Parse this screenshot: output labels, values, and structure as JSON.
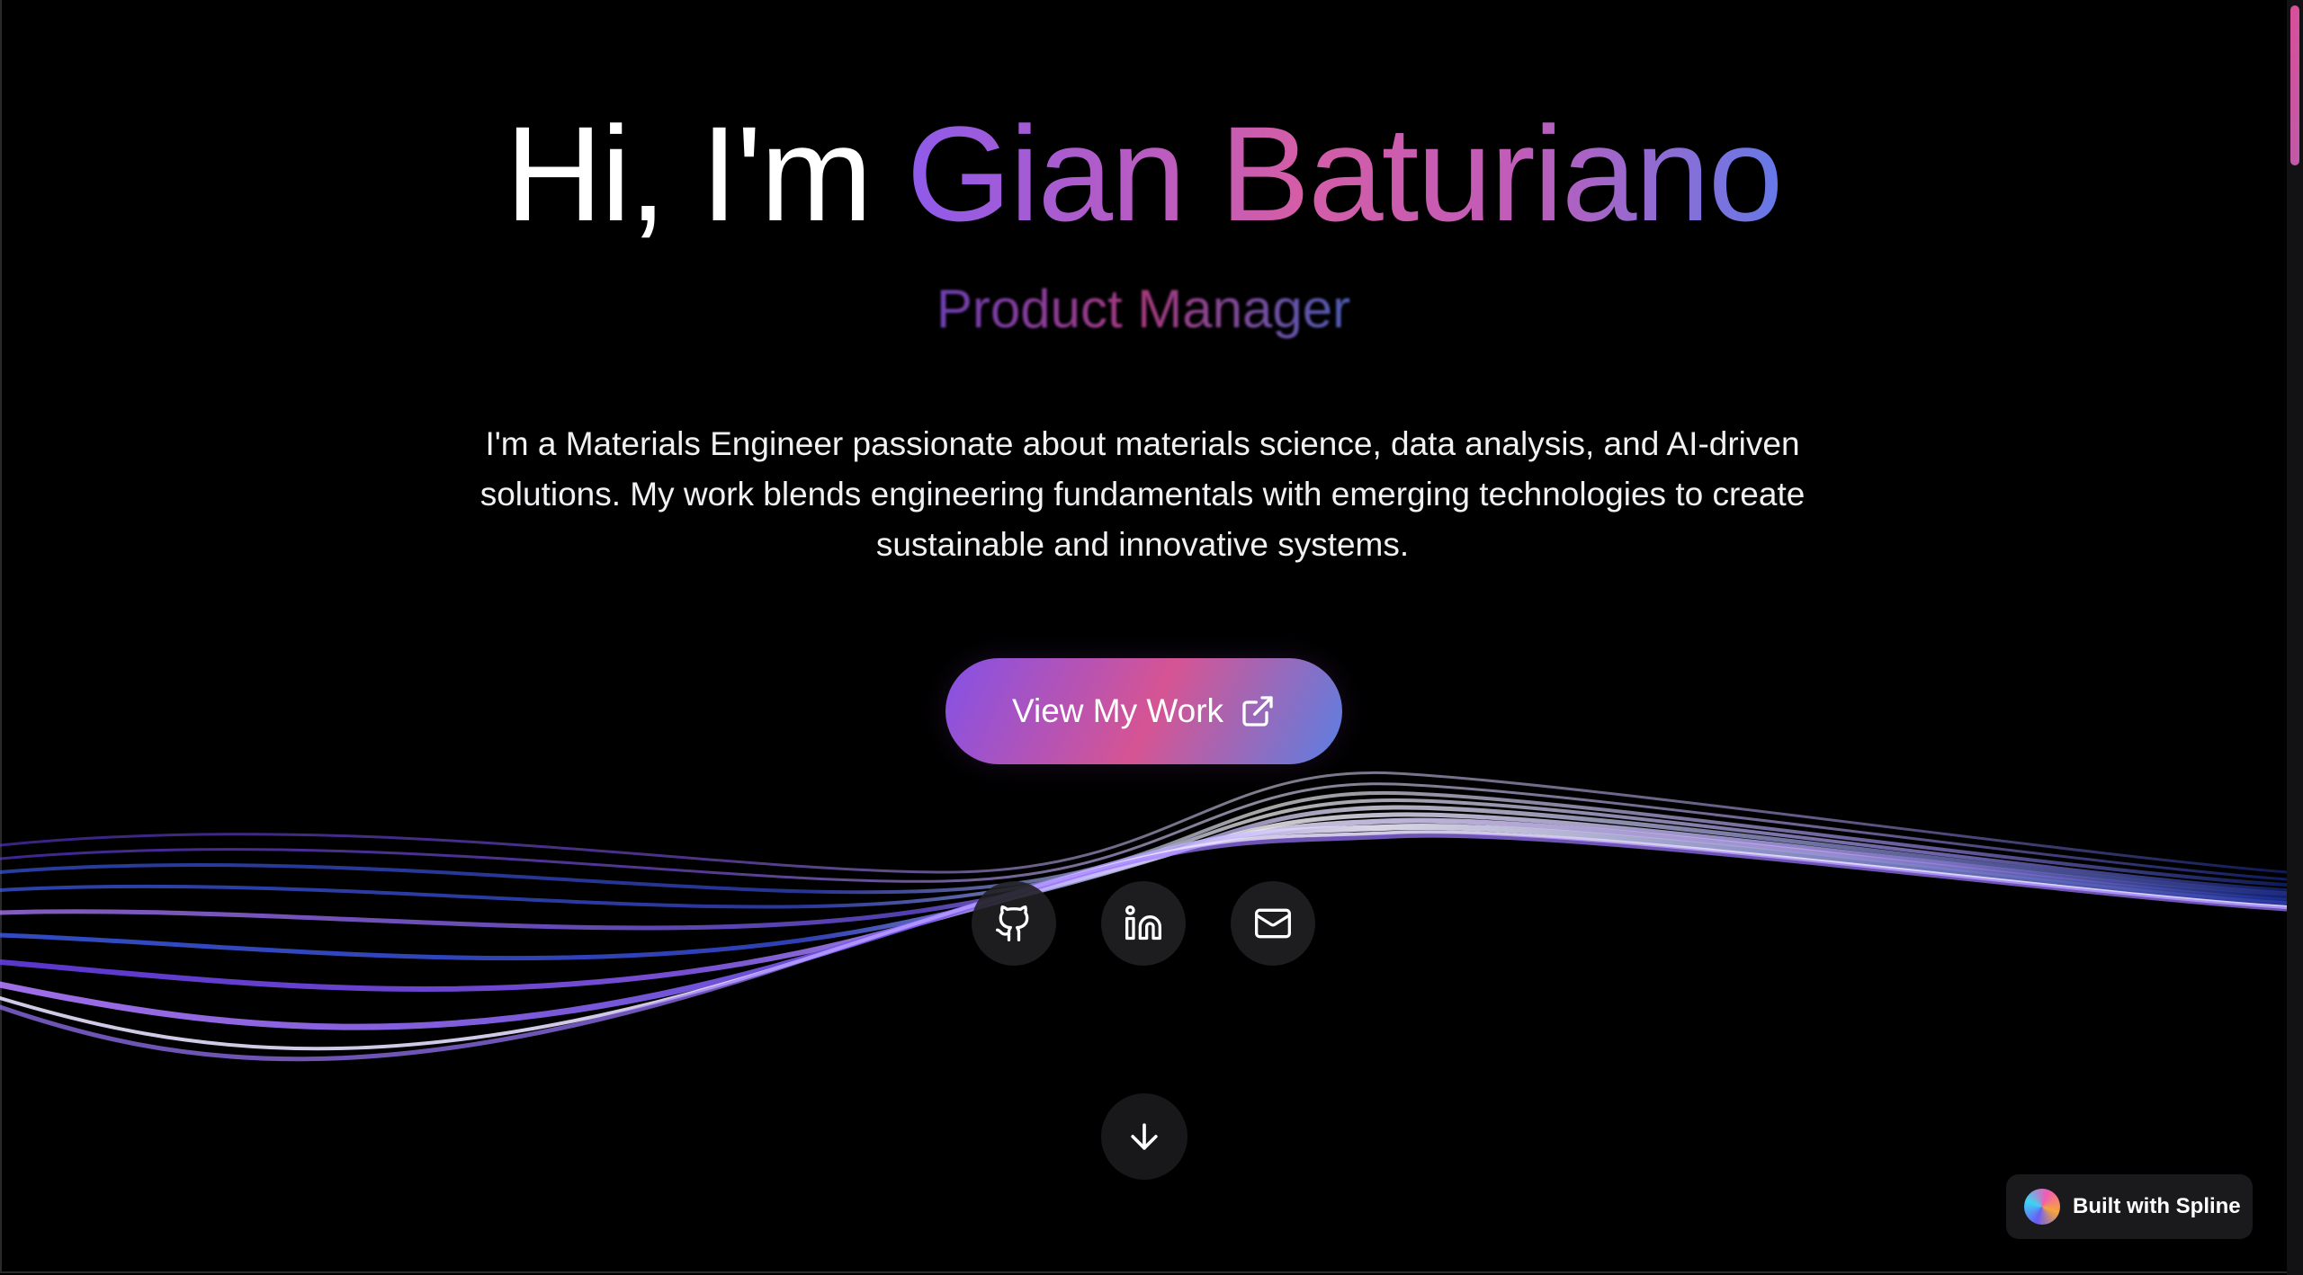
{
  "hero": {
    "greeting": "Hi, I'm ",
    "name": "Gian Baturiano",
    "role": "Product Manager",
    "bio": "I'm a Materials Engineer passionate about materials science, data analysis, and AI-driven solutions. My work blends engineering fundamentals with emerging technologies to create sustainable and innovative systems."
  },
  "cta": {
    "label": "View My Work",
    "icon": "external-link-icon"
  },
  "social": {
    "items": [
      {
        "icon": "github-icon"
      },
      {
        "icon": "linkedin-icon"
      },
      {
        "icon": "mail-icon"
      }
    ]
  },
  "scroll": {
    "icon": "arrow-down-icon"
  },
  "badge": {
    "label": "Built with Spline"
  },
  "colors": {
    "background": "#000000",
    "accent_purple": "#8e5bea",
    "accent_pink": "#d45da6",
    "accent_blue": "#6579e8"
  }
}
